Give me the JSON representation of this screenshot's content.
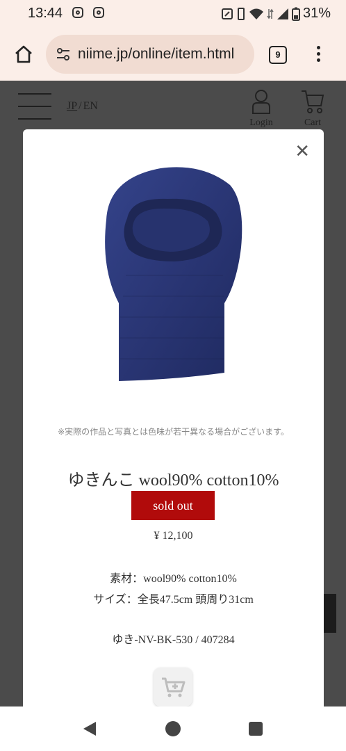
{
  "status_bar": {
    "time": "13:44",
    "battery": "31%",
    "icons": [
      "instagram-icon",
      "instagram-icon",
      "nfc-icon",
      "vibrate-icon",
      "wifi-icon",
      "data-icon",
      "signal-icon",
      "battery-icon"
    ]
  },
  "browser": {
    "url": "niime.jp/online/item.html",
    "tab_count": "9",
    "icons": [
      "home-icon",
      "site-settings-icon",
      "tabs-icon",
      "more-icon"
    ]
  },
  "site_header": {
    "lang_jp": "JP",
    "lang_sep": "/",
    "lang_en": "EN",
    "login_label": "Login",
    "cart_label": "Cart"
  },
  "modal": {
    "close_glyph": "✕",
    "image_alt": "navy knit balaclava",
    "notice": "※実際の作品と写真とは色味が若干異なる場合がございます。",
    "title": "ゆきんこ wool90% cotton10%",
    "status_button": "sold out",
    "price": "¥ 12,100",
    "material": "素材：wool90% cotton10%",
    "size": "サイズ：全長47.5cm 頭周り31cm",
    "sku": "ゆき-NV-BK-530 / 407284"
  },
  "colors": {
    "browser_bg": "#fbeee8",
    "url_bg": "#f1dcd2",
    "overlay_bg": "#4b4b4b",
    "sold_out_red": "#b10b0b",
    "product_navy": "#2c3a78"
  },
  "nav_bar": {
    "icons": [
      "back-icon",
      "home-circle-icon",
      "recents-icon"
    ]
  }
}
